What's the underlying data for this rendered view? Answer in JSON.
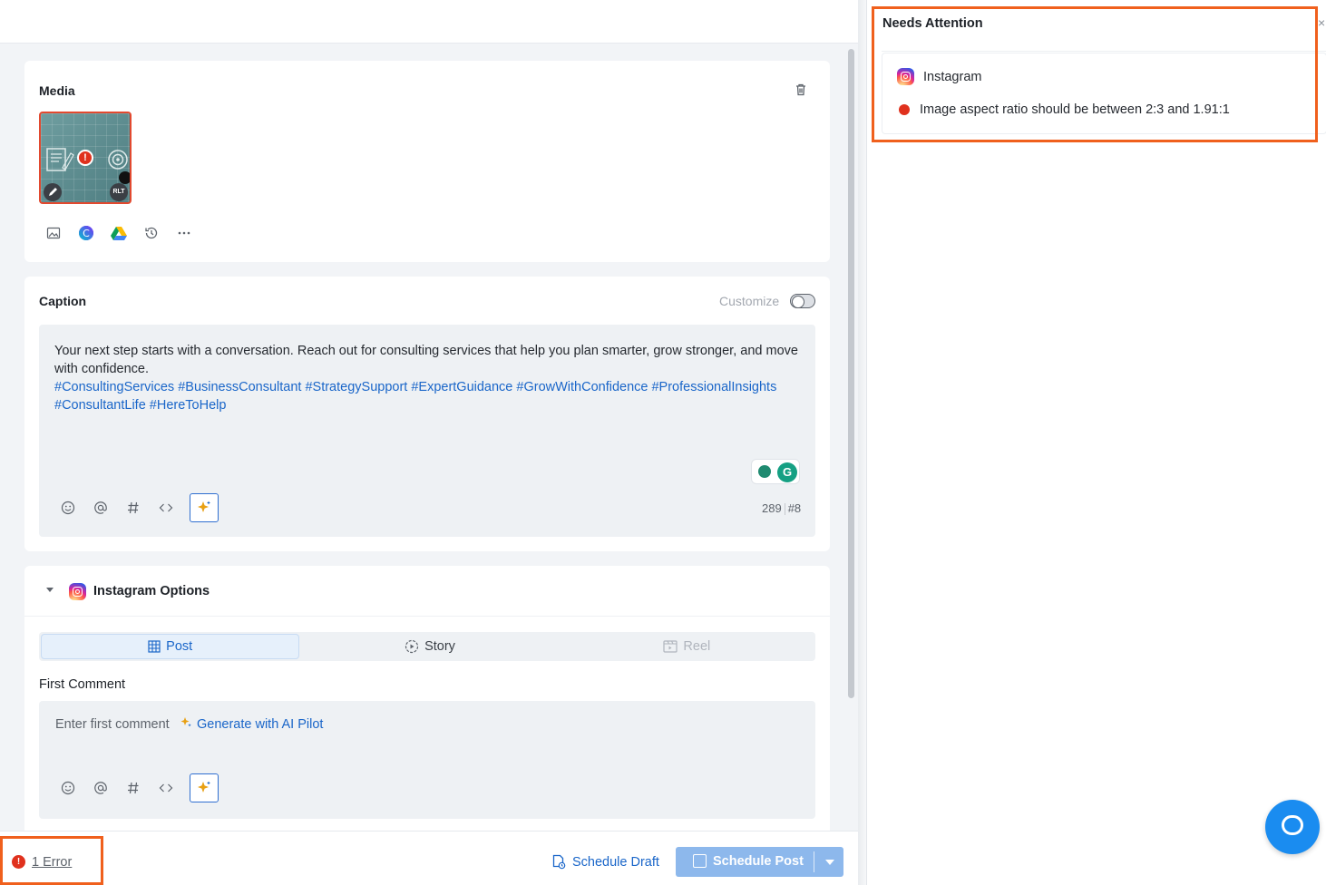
{
  "media": {
    "title": "Media",
    "thumb_alt_badge": "RLT",
    "thumb_error_glyph": "!",
    "tools": [
      "image-upload-icon",
      "canva-icon",
      "google-drive-icon",
      "history-icon",
      "more-icon"
    ]
  },
  "caption": {
    "title": "Caption",
    "customize_label": "Customize",
    "text": "Your next step starts with a conversation. Reach out for consulting services that help you plan smarter, grow stronger, and move with confidence.",
    "hashtags": "#ConsultingServices #BusinessConsultant #StrategySupport #ExpertGuidance #GrowWithConfidence #ProfessionalInsights #ConsultantLife #HereToHelp",
    "char_count": "289",
    "hashtag_count": "#8",
    "grammarly_glyph": "G",
    "tools": [
      "emoji-icon",
      "mention-icon",
      "hashtag-icon",
      "code-icon",
      "ai-sparkle-icon"
    ]
  },
  "instagram": {
    "title": "Instagram Options",
    "tabs": [
      {
        "label": "Post",
        "state": "active"
      },
      {
        "label": "Story",
        "state": "normal"
      },
      {
        "label": "Reel",
        "state": "disabled"
      }
    ],
    "first_comment_label": "First Comment",
    "first_comment_placeholder": "Enter first comment",
    "generate_label": "Generate with AI Pilot"
  },
  "footer": {
    "error_glyph": "!",
    "error_text": "1 Error",
    "draft_label": "Schedule Draft",
    "schedule_label": "Schedule Post"
  },
  "needs_attention": {
    "title": "Needs Attention",
    "close_glyph": "×",
    "platform": "Instagram",
    "error_message": "Image aspect ratio should be between 2:3 and 1.91:1"
  },
  "colors": {
    "accent": "#1a66c9",
    "error": "#e0311d",
    "highlight": "#f0601d",
    "schedule_button": "#8db8ec",
    "chat_button": "#1a8cf0"
  }
}
